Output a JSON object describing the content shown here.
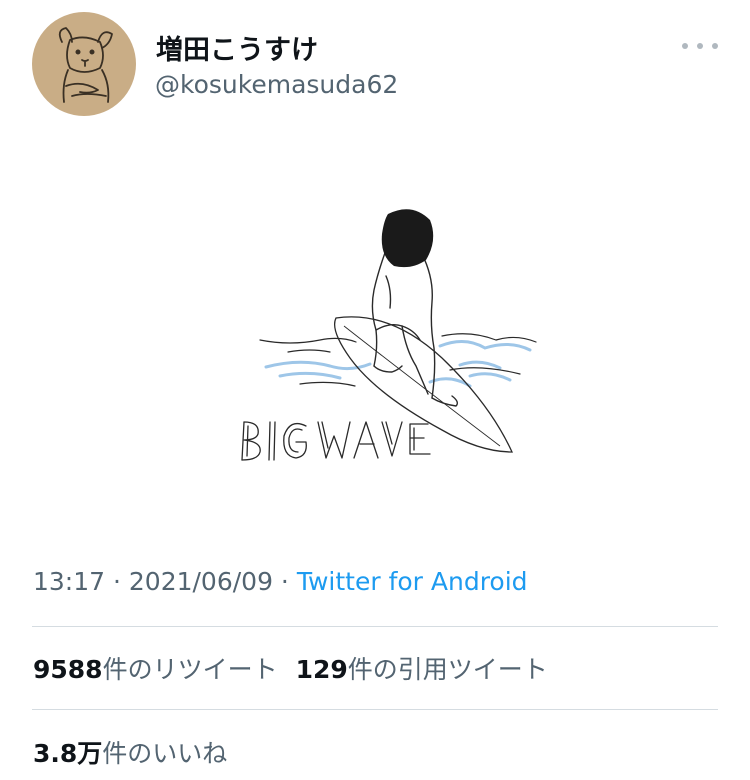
{
  "tweet": {
    "author": {
      "name": "増田こうすけ",
      "handle": "@kosukemasuda62",
      "avatar_icon": "dog-avatar-icon"
    },
    "more_icon": "more-options-icon",
    "image": {
      "caption_text": "BIG WAVE",
      "colors": {
        "ink": "#2a2a2a",
        "water": "#9ec6e8"
      }
    },
    "meta": {
      "time": "13:17",
      "separator": " · ",
      "date": "2021/06/09",
      "source": "Twitter for Android"
    },
    "stats": {
      "retweets": {
        "count": "9588",
        "label": "件のリツイート"
      },
      "quotes": {
        "count": "129",
        "label": "件の引用ツイート"
      },
      "likes": {
        "count": "3.8万",
        "label": "件のいいね"
      }
    }
  },
  "colors": {
    "accent": "#1d9bf0",
    "secondary_text": "#536471",
    "divider": "#d5dce1"
  }
}
